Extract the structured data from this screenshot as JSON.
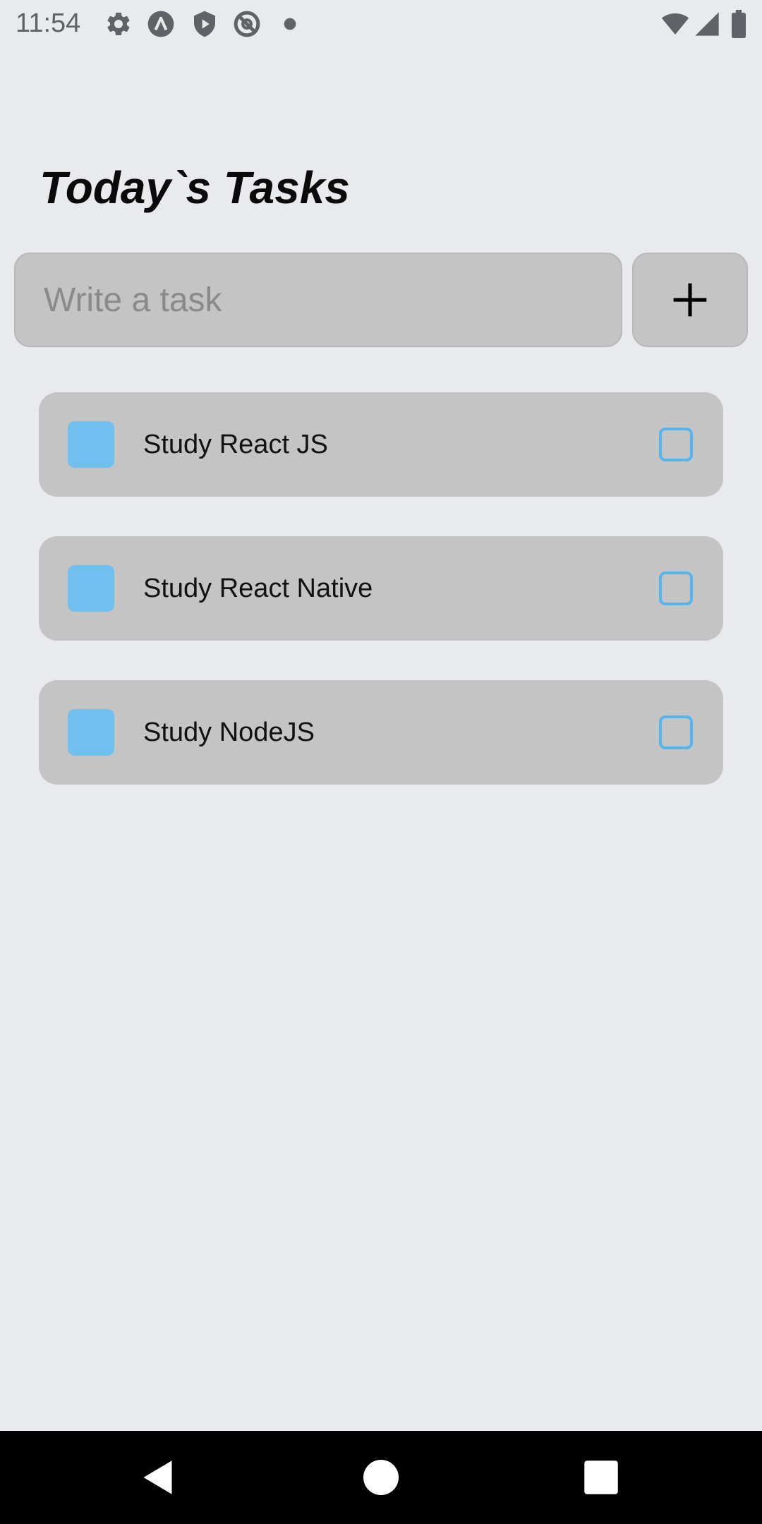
{
  "status_bar": {
    "time": "11:54",
    "icons": [
      "settings-icon",
      "app-a-icon",
      "shield-play-icon",
      "no-disturb-icon",
      "dot-icon",
      "wifi-icon",
      "signal-icon",
      "battery-icon"
    ]
  },
  "header": {
    "title": "Today`s Tasks"
  },
  "composer": {
    "placeholder": "Write a task",
    "value": "",
    "add_icon": "plus-icon"
  },
  "tasks": [
    {
      "label": "Study React JS",
      "completed": false
    },
    {
      "label": "Study React Native",
      "completed": false
    },
    {
      "label": "Study NodeJS",
      "completed": false
    }
  ],
  "nav_bar": {
    "buttons": [
      "back-icon",
      "home-icon",
      "recents-icon"
    ]
  },
  "colors": {
    "background": "#e8eaed",
    "card": "#c4c4c4",
    "accent": "#6fc0ee",
    "checkbox_border": "#58b4ec",
    "title": "#0a0a0a"
  }
}
